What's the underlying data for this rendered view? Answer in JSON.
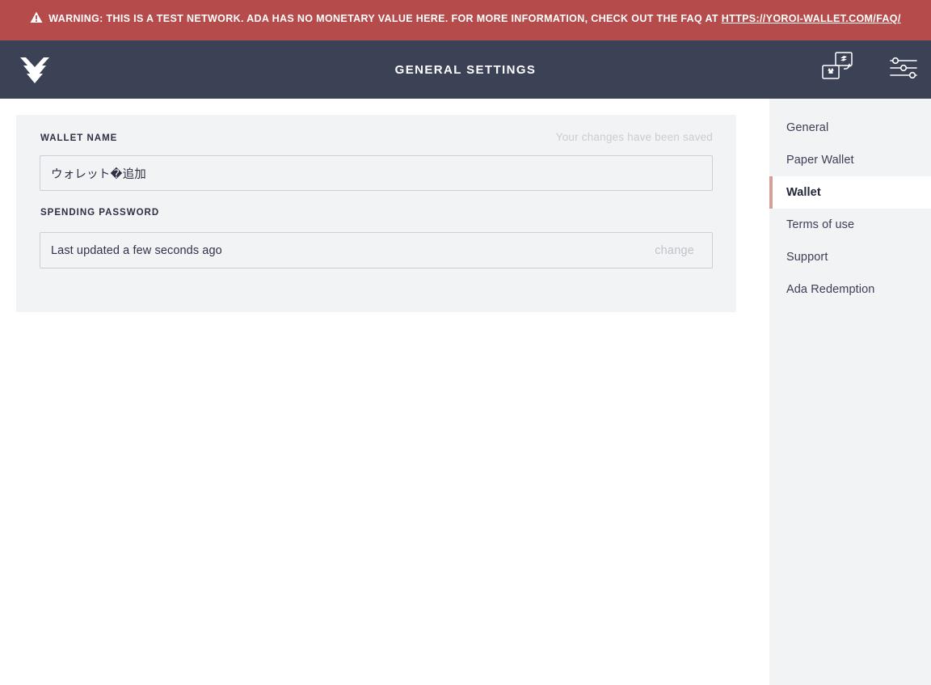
{
  "banner": {
    "icon": "warning-triangle-icon",
    "text": "WARNING: THIS IS A TEST NETWORK. ADA HAS NO MONETARY VALUE HERE. FOR MORE INFORMATION, CHECK OUT THE FAQ AT ",
    "link_text": "HTTPS://YOROI-WALLET.COM/FAQ/",
    "background": "#b54b4b",
    "text_color": "#ffffff"
  },
  "topbar": {
    "logo": "yoroi-logo-icon",
    "title": "GENERAL SETTINGS",
    "background": "#3b4256",
    "actions": [
      {
        "name": "wallet-switch-icon",
        "label": ""
      },
      {
        "name": "settings-sliders-icon",
        "label": "",
        "active": true
      }
    ],
    "active_indicator_color": "#dba59d"
  },
  "settings": {
    "card_background": "#f2f3f5",
    "saved_message": "Your changes have been saved",
    "wallet_name": {
      "label": "WALLET NAME",
      "value": "ウォレット�追加",
      "placeholder": "Wallet name"
    },
    "spending_password": {
      "label": "SPENDING PASSWORD",
      "status": "Last updated a few seconds ago",
      "change_label": "change"
    }
  },
  "menu": {
    "background": "#f2f3f5",
    "active_border_color": "#d2a097",
    "items": [
      {
        "label": "General",
        "active": false
      },
      {
        "label": "Paper Wallet",
        "active": false
      },
      {
        "label": "Wallet",
        "active": true
      },
      {
        "label": "Terms of use",
        "active": false
      },
      {
        "label": "Support",
        "active": false
      },
      {
        "label": "Ada Redemption",
        "active": false
      }
    ]
  }
}
